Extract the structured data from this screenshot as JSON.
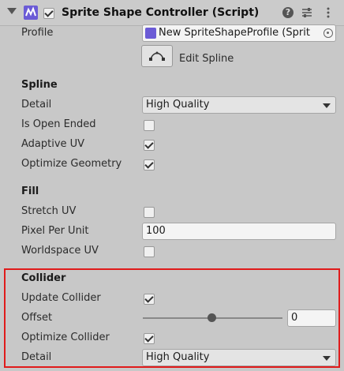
{
  "header": {
    "title": "Sprite Shape Controller (Script)",
    "enabled": true,
    "icons": [
      "foldout-arrow-icon",
      "sprite-shape-controller-icon",
      "help-icon",
      "presets-icon",
      "kebab-menu-icon"
    ]
  },
  "profile": {
    "label": "Profile",
    "value": "New SpriteShapeProfile (Sprit",
    "icons": [
      "sprite-shape-profile-icon",
      "object-picker-icon"
    ]
  },
  "edit_spline": {
    "label": "Edit Spline",
    "icon": "bezier-curve-icon"
  },
  "spline": {
    "section_label": "Spline",
    "detail_label": "Detail",
    "detail_value": "High Quality",
    "open_ended_label": "Is Open Ended",
    "open_ended": false,
    "adaptive_uv_label": "Adaptive UV",
    "adaptive_uv": true,
    "optimize_geometry_label": "Optimize Geometry",
    "optimize_geometry": true
  },
  "fill": {
    "section_label": "Fill",
    "stretch_uv_label": "Stretch UV",
    "stretch_uv": false,
    "pixel_per_unit_label": "Pixel Per Unit",
    "pixel_per_unit_value": "100",
    "worldspace_uv_label": "Worldspace UV",
    "worldspace_uv": false
  },
  "collider": {
    "section_label": "Collider",
    "update_collider_label": "Update Collider",
    "update_collider": true,
    "offset_label": "Offset",
    "offset_value": "0",
    "offset_slider_fraction": 0.5,
    "optimize_collider_label": "Optimize Collider",
    "optimize_collider": true,
    "detail_label": "Detail",
    "detail_value": "High Quality"
  },
  "colors": {
    "highlight": "#e01b1b",
    "component_icon": "#6b5bd6"
  }
}
